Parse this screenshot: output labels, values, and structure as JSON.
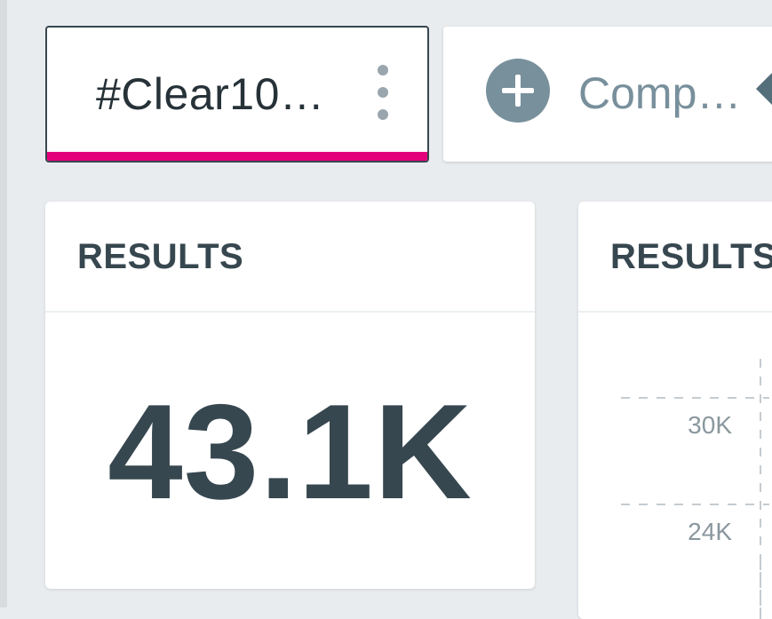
{
  "tabs": [
    {
      "label": "#Clear10…",
      "active": true,
      "accent_color": "#e3007a"
    },
    {
      "label": "Comp…",
      "icon": "plus-circle-icon"
    }
  ],
  "cards": [
    {
      "title": "RESULTS",
      "value": "43.1K"
    },
    {
      "title": "RESULTS"
    }
  ],
  "chart_data": {
    "type": "line",
    "title": "",
    "xlabel": "",
    "ylabel": "",
    "y_tick_labels": [
      "30K",
      "24K"
    ],
    "grid": true
  }
}
